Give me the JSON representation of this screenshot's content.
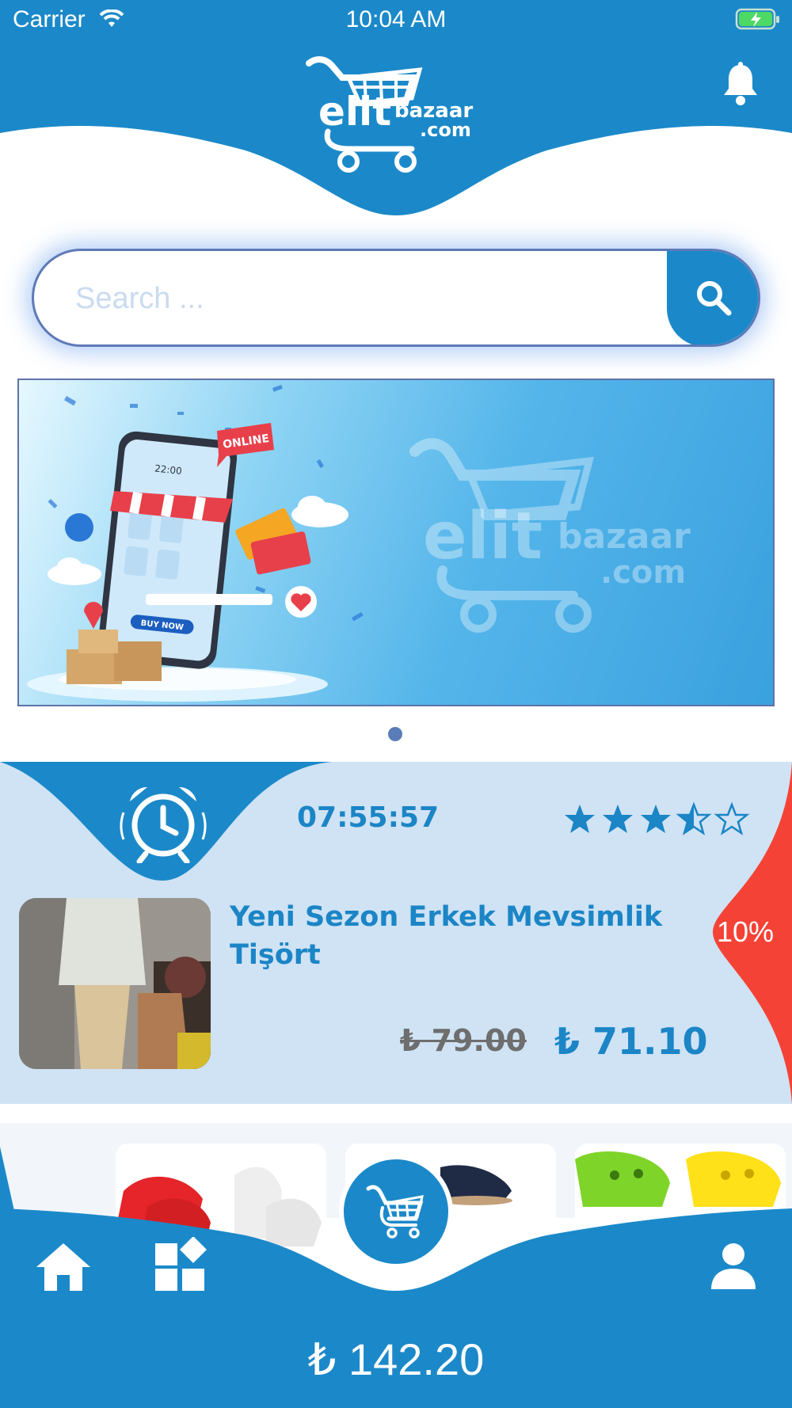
{
  "status_bar": {
    "carrier": "Carrier",
    "time": "10:04 AM"
  },
  "header": {
    "brand_logo": "elitbazaar.com",
    "notification_icon": "bell-icon"
  },
  "search": {
    "placeholder": "Search ...",
    "value": "",
    "icon": "search-icon"
  },
  "banner": {
    "badge": "ONLINE",
    "phone_time": "22:00",
    "button": "BUY NOW",
    "watermark": "elitbazaar.com",
    "page_count": 1,
    "active_page": 1
  },
  "deal": {
    "icon": "alarm-clock-icon",
    "countdown": "07:55:57",
    "rating": 3.5,
    "rating_max": 5,
    "title": "Yeni Sezon Erkek Mevsimlik Tişört",
    "old_price": "₺ 79.00",
    "new_price": "₺ 71.10",
    "discount": "10%"
  },
  "products": [
    {
      "name": "red-white-sneakers"
    },
    {
      "name": "dark-shoes"
    },
    {
      "name": "green-yellow-clogs"
    }
  ],
  "bottom_nav": {
    "items": [
      "home-icon",
      "categories-icon",
      "cart-icon",
      "profile-icon"
    ],
    "cart_total": "₺ 142.20"
  },
  "colors": {
    "primary": "#1b89c9",
    "deal_bg": "#cfe3f4",
    "discount": "#f44336"
  }
}
